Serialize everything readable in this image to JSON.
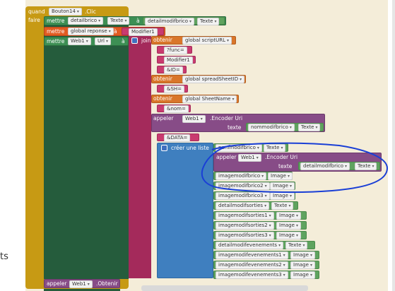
{
  "event": {
    "when": "quand",
    "component": "Bouton14",
    "event": ".Clic",
    "do": "faire"
  },
  "set1": {
    "set": "mettre",
    "component": "detailbrico",
    "prop": "Texte",
    "to": "à",
    "getComp": "detailmodifbrico",
    "getProp": "Texte"
  },
  "set2": {
    "set": "mettre",
    "var": "global reponse",
    "to": "à",
    "value": "Modifier1"
  },
  "set3": {
    "set": "mettre",
    "component": "Web1",
    "prop": "Url",
    "to": "à",
    "join": "joint"
  },
  "join_items": [
    {
      "get": "obtenir",
      "var": "global scriptURL"
    },
    {
      "text": "?func="
    },
    {
      "text": "Modifier1"
    },
    {
      "text": "&ID="
    },
    {
      "get": "obtenir",
      "var": "global spreadSheetID"
    },
    {
      "text": "&SH="
    },
    {
      "get": "obtenir",
      "var": "global SheetName"
    },
    {
      "text": "&nom="
    }
  ],
  "encode1": {
    "call": "appeler",
    "component": "Web1",
    "method": ".Encoder Uri",
    "param": "texte",
    "argComp": "nommodifbrico",
    "argProp": "Texte"
  },
  "data_text": "&DATA=",
  "list": {
    "label": "créer une liste"
  },
  "list_first": {
    "comp": "nommodifbrico",
    "prop": "Texte"
  },
  "encode2": {
    "call": "appeler",
    "component": "Web1",
    "method": ".Encoder Uri",
    "param": "texte",
    "argComp": "detailmodifbrico",
    "argProp": "Texte"
  },
  "list_items": [
    {
      "comp": "imagemodifbrico",
      "prop": "Image"
    },
    {
      "comp": "imagemodifbrico2",
      "prop": "Image"
    },
    {
      "comp": "imagemodifbrico3",
      "prop": "Image"
    },
    {
      "comp": "detailmodifsorties",
      "prop": "Texte"
    },
    {
      "comp": "imagemodifsorties1",
      "prop": "Image"
    },
    {
      "comp": "imagemodifsorties2",
      "prop": "Image"
    },
    {
      "comp": "imagemodifsorties3",
      "prop": "Image"
    },
    {
      "comp": "detailmodifevenements",
      "prop": "Texte"
    },
    {
      "comp": "imagemodifevenements1",
      "prop": "Image"
    },
    {
      "comp": "imagemodifevenements2",
      "prop": "Image"
    },
    {
      "comp": "imagemodifevenements3",
      "prop": "Image"
    }
  ],
  "footer": {
    "call": "appeler",
    "component": "Web1",
    "method": ".Obtenir"
  },
  "side_text": "ts"
}
